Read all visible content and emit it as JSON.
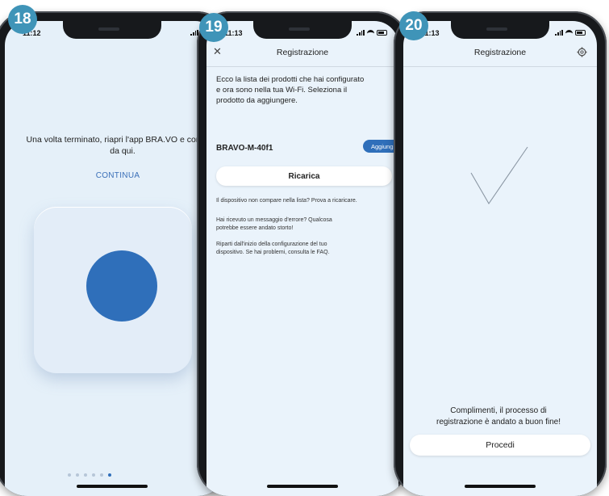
{
  "steps": {
    "s18": "18",
    "s19": "19",
    "s20": "20"
  },
  "colors": {
    "accent": "#2f6fba",
    "badge": "#3f94b8",
    "screen_bg": "#eaf3fb"
  },
  "phone18": {
    "time": "11:12",
    "message": "Una volta terminato, riapri l'app BRA.VO e continua da qui.",
    "continue_label": "CONTINUA",
    "page_dots_count": 6,
    "active_dot": 6
  },
  "phone19": {
    "time": "11:13",
    "nav_title": "Registrazione",
    "close_icon": "✕",
    "intro_lines": [
      "Ecco la lista dei prodotti che hai configurato",
      "e ora sono nella tua Wi-Fi. Seleziona il",
      "prodotto da aggiungere."
    ],
    "device_name": "BRAVO-M-40f1",
    "add_label": "Aggiungi",
    "reload_label": "Ricarica",
    "help_items": [
      [
        "Il dispositivo non compare nella lista? Prova a ricaricare."
      ],
      [
        "Hai ricevuto un messaggio d'errore? Qualcosa",
        "potrebbe essere andato storto!"
      ],
      [
        "Riparti dall'inizio della configurazione del tuo",
        "dispositivo. Se hai problemi, consulta le FAQ."
      ]
    ]
  },
  "phone20": {
    "time": "11:13",
    "nav_title": "Registrazione",
    "success_line1": "Complimenti, il processo di",
    "success_line2": "registrazione è andato a buon fine!",
    "proceed_label": "Procedi"
  }
}
